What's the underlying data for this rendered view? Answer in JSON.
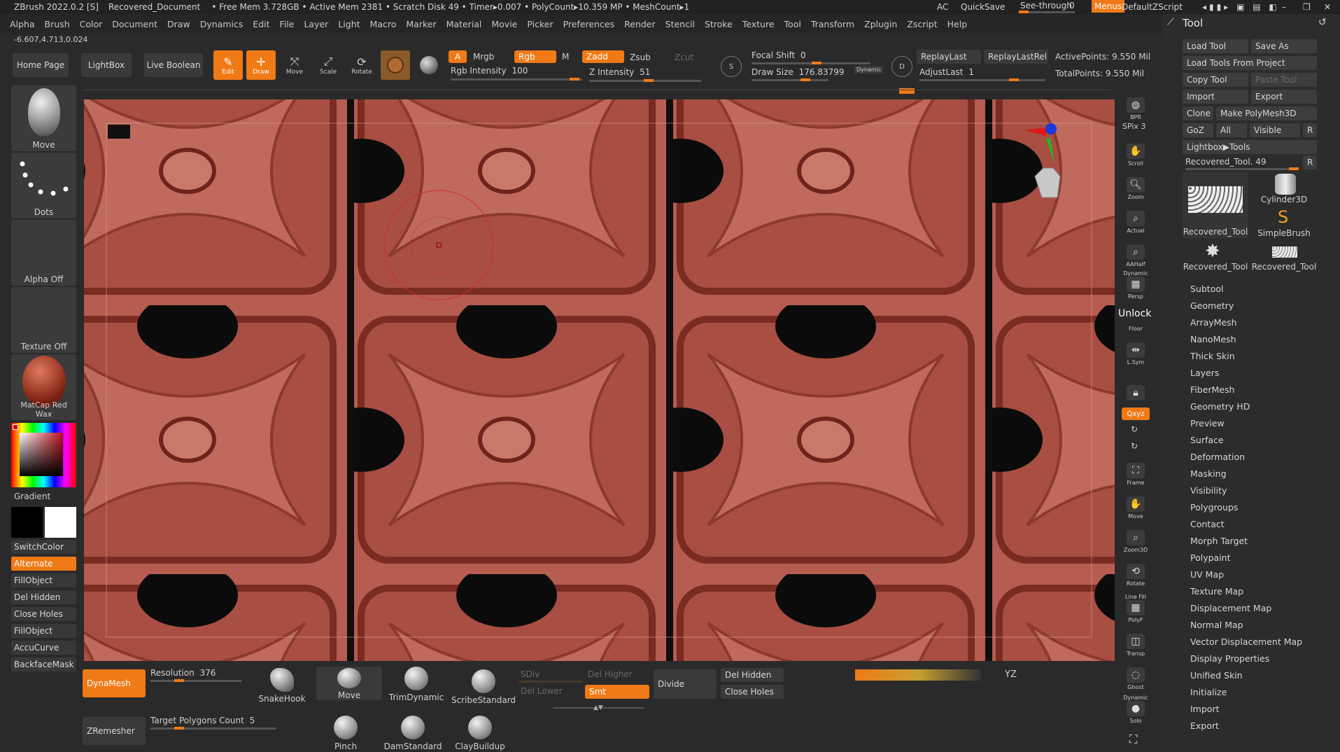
{
  "titlebar": {
    "app": "ZBrush 2022.0.2 [S]",
    "document": "Recovered_Document",
    "stats": "• Free Mem 3.728GB • Active Mem 2381 • Scratch Disk 49 • Timer▸0.007 • PolyCount▸10.359 MP • MeshCount▸1",
    "ac": "AC",
    "quicksave": "QuickSave",
    "seethrough_label": "See-through",
    "seethrough_value": "0",
    "menus": "Menus",
    "defaultzscript": "DefaultZScript"
  },
  "menubar": [
    "Alpha",
    "Brush",
    "Color",
    "Document",
    "Draw",
    "Dynamics",
    "Edit",
    "File",
    "Layer",
    "Light",
    "Macro",
    "Marker",
    "Material",
    "Movie",
    "Picker",
    "Preferences",
    "Render",
    "Stencil",
    "Stroke",
    "Texture",
    "Tool",
    "Transform",
    "Zplugin",
    "Zscript",
    "Help"
  ],
  "coords": "-6.607,4.713,0.024",
  "shelf": {
    "home": "Home Page",
    "lightbox": "LightBox",
    "liveboolean": "Live Boolean",
    "edit": "Edit",
    "draw": "Draw",
    "move": "Move",
    "scale": "Scale",
    "rotate": "Rotate",
    "a": "A",
    "mrgb": "Mrgb",
    "rgb": "Rgb",
    "m": "M",
    "zadd": "Zadd",
    "zsub": "Zsub",
    "zcut": "Zcut",
    "rgb_intensity_label": "Rgb Intensity",
    "rgb_intensity_value": "100",
    "z_intensity_label": "Z Intensity",
    "z_intensity_value": "51",
    "focal_shift_label": "Focal Shift",
    "focal_shift_value": "0",
    "draw_size_label": "Draw Size",
    "draw_size_value": "176.83799",
    "dynamic": "Dynamic",
    "replaylast": "ReplayLast",
    "replaylastrel": "ReplayLastRel",
    "adjustlast_label": "AdjustLast",
    "adjustlast_value": "1",
    "activepoints": "ActivePoints: 9.550 Mil",
    "totalpoints": "TotalPoints: 9.550 Mil",
    "s": "S",
    "d": "D"
  },
  "left": {
    "move": "Move",
    "dots": "Dots",
    "alpha_off": "Alpha Off",
    "texture_off": "Texture Off",
    "matcap": "MatCap Red Wax",
    "gradient": "Gradient",
    "buttons": [
      "SwitchColor",
      "Alternate",
      "FillObject",
      "Del Hidden",
      "Close Holes",
      "FillObject",
      "AccuCurve",
      "BackfaceMask"
    ]
  },
  "nav": {
    "bpr": "BPR",
    "spix": "SPix 3",
    "scroll": "Scroll",
    "zoom": "Zoom",
    "actual": "Actual",
    "aahalf": "AAHalf",
    "dynamic": "Dynamic",
    "persp": "Persp",
    "unlock": "Unlock",
    "floor": "Floor",
    "lsym": "L.Sym",
    "xyz": "Qxyz",
    "frame": "Frame",
    "move": "Move",
    "zoom3d": "Zoom3D",
    "rotate": "Rotate",
    "linefill": "Line Fill",
    "polyf": "PolyF",
    "transp": "Transp",
    "ghost": "Ghost",
    "solo": "Solo"
  },
  "tool": {
    "title": "Tool",
    "load_tool": "Load Tool",
    "save_as": "Save As",
    "load_from_project": "Load Tools From Project",
    "copy_tool": "Copy Tool",
    "paste_tool": "Paste Tool",
    "import": "Import",
    "export": "Export",
    "clone": "Clone",
    "make_polymesh": "Make PolyMesh3D",
    "goz": "GoZ",
    "all": "All",
    "visible": "Visible",
    "r": "R",
    "lightbox_tools": "Lightbox▶Tools",
    "current_tool": "Recovered_Tool. 49",
    "thumbs": [
      "Recovered_Tool",
      "Cylinder3D",
      "SimpleBrush",
      "Recovered_Tool",
      "Recovered_Tool"
    ],
    "subpalettes": [
      "Subtool",
      "Geometry",
      "ArrayMesh",
      "NanoMesh",
      "Thick Skin",
      "Layers",
      "FiberMesh",
      "Geometry HD",
      "Preview",
      "Surface",
      "Deformation",
      "Masking",
      "Visibility",
      "Polygroups",
      "Contact",
      "Morph Target",
      "Polypaint",
      "UV Map",
      "Texture Map",
      "Displacement Map",
      "Normal Map",
      "Vector Displacement Map",
      "Display Properties",
      "Unified Skin",
      "Initialize",
      "Import",
      "Export"
    ]
  },
  "bottom": {
    "dynamesh": "DynaMesh",
    "resolution_label": "Resolution",
    "resolution_value": "376",
    "zremesher": "ZRemesher",
    "target_label": "Target Polygons Count",
    "target_value": "5",
    "brushes_top": [
      "SnakeHook",
      "Move",
      "TrimDynamic",
      "ScribeStandard"
    ],
    "brushes_bottom": [
      "Pinch",
      "DamStandard",
      "ClayBuildup"
    ],
    "sdiv": "SDiv",
    "del_higher": "Del Higher",
    "del_lower": "Del Lower",
    "smt": "Smt",
    "divide": "Divide",
    "del_hidden": "Del Hidden",
    "close_holes": "Close Holes",
    "yz": "YZ"
  },
  "colors": {
    "accent": "#f07a16",
    "clay": "#b25a4f"
  }
}
